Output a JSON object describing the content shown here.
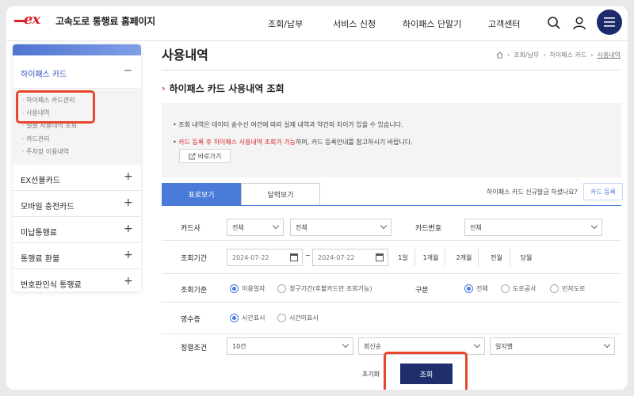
{
  "header": {
    "logo_mark": "ex",
    "site_title": "고속도로 통행료 홈페이지",
    "nav": [
      "조회/납부",
      "서비스 신청",
      "하이패스 단말기",
      "고객센터"
    ],
    "icons": [
      "search-icon",
      "user-icon",
      "menu-icon"
    ]
  },
  "sidebar": {
    "section": "하이패스 카드",
    "section_sign": "−",
    "sub_items": [
      "하이패스 카드관리",
      "사용내역",
      "일괄 사용내역 조회",
      "카드관리",
      "주차장 이용내역"
    ],
    "groups": [
      {
        "label": "EX선불카드",
        "sign": "+"
      },
      {
        "label": "모바일 충전카드",
        "sign": "+"
      },
      {
        "label": "미납통행료",
        "sign": "+"
      },
      {
        "label": "통행료 환불",
        "sign": "+"
      },
      {
        "label": "번호판인식 통행료",
        "sign": "+"
      }
    ]
  },
  "page": {
    "title": "사용내역",
    "breadcrumb": [
      "조회/납부",
      "하이패스 카드",
      "사용내역"
    ],
    "section_title": "하이패스 카드 사용내역 조회",
    "notice": {
      "line1": "조회 내역은 데이터 송수신 여건에 따라 실제 내역과 약간의 차이가 있을 수 있습니다.",
      "line2_red": "카드 등록 후 하이패스 사용내역 조회가 가능",
      "line2_rest": "하며, 카드 등록안내를 참고하시기 바랍니다.",
      "link": "바로가기"
    },
    "tabs": [
      "표로보기",
      "달력보기"
    ],
    "card_question": "하이패스 카드 신규발급 하셨나요?",
    "register_button": "카드 등록"
  },
  "form": {
    "card_company_label": "카드사",
    "card_company_value": "전체",
    "card_company_value2": "전체",
    "card_number_label": "카드번호",
    "card_number_value": "전체",
    "period_label": "조회기간",
    "date_from": "2024-07-22",
    "date_to": "2024-07-22",
    "date_sep": "~",
    "quick_ranges": [
      "1일",
      "1개월",
      "2개월",
      "전월",
      "당월"
    ],
    "basis_label": "조회기준",
    "basis_options": [
      "이용일자",
      "청구기간(후불카드만 조회가능)"
    ],
    "basis_selected": 0,
    "type_label": "구분",
    "type_options": [
      "전체",
      "도로공사",
      "민자도로"
    ],
    "type_selected": 0,
    "receipt_label": "영수증",
    "receipt_options": [
      "시간표시",
      "시간미표시"
    ],
    "receipt_selected": 0,
    "sort_label": "정렬조건",
    "sort_count": "10건",
    "sort_order": "최신순",
    "sort_scope": "일자별",
    "reset_button": "초기화",
    "search_button": "조회"
  },
  "colors": {
    "brand_red": "#d8232a",
    "navy": "#1c2a6b",
    "tab_blue": "#4a7bd8",
    "highlight": "#e8472c"
  }
}
